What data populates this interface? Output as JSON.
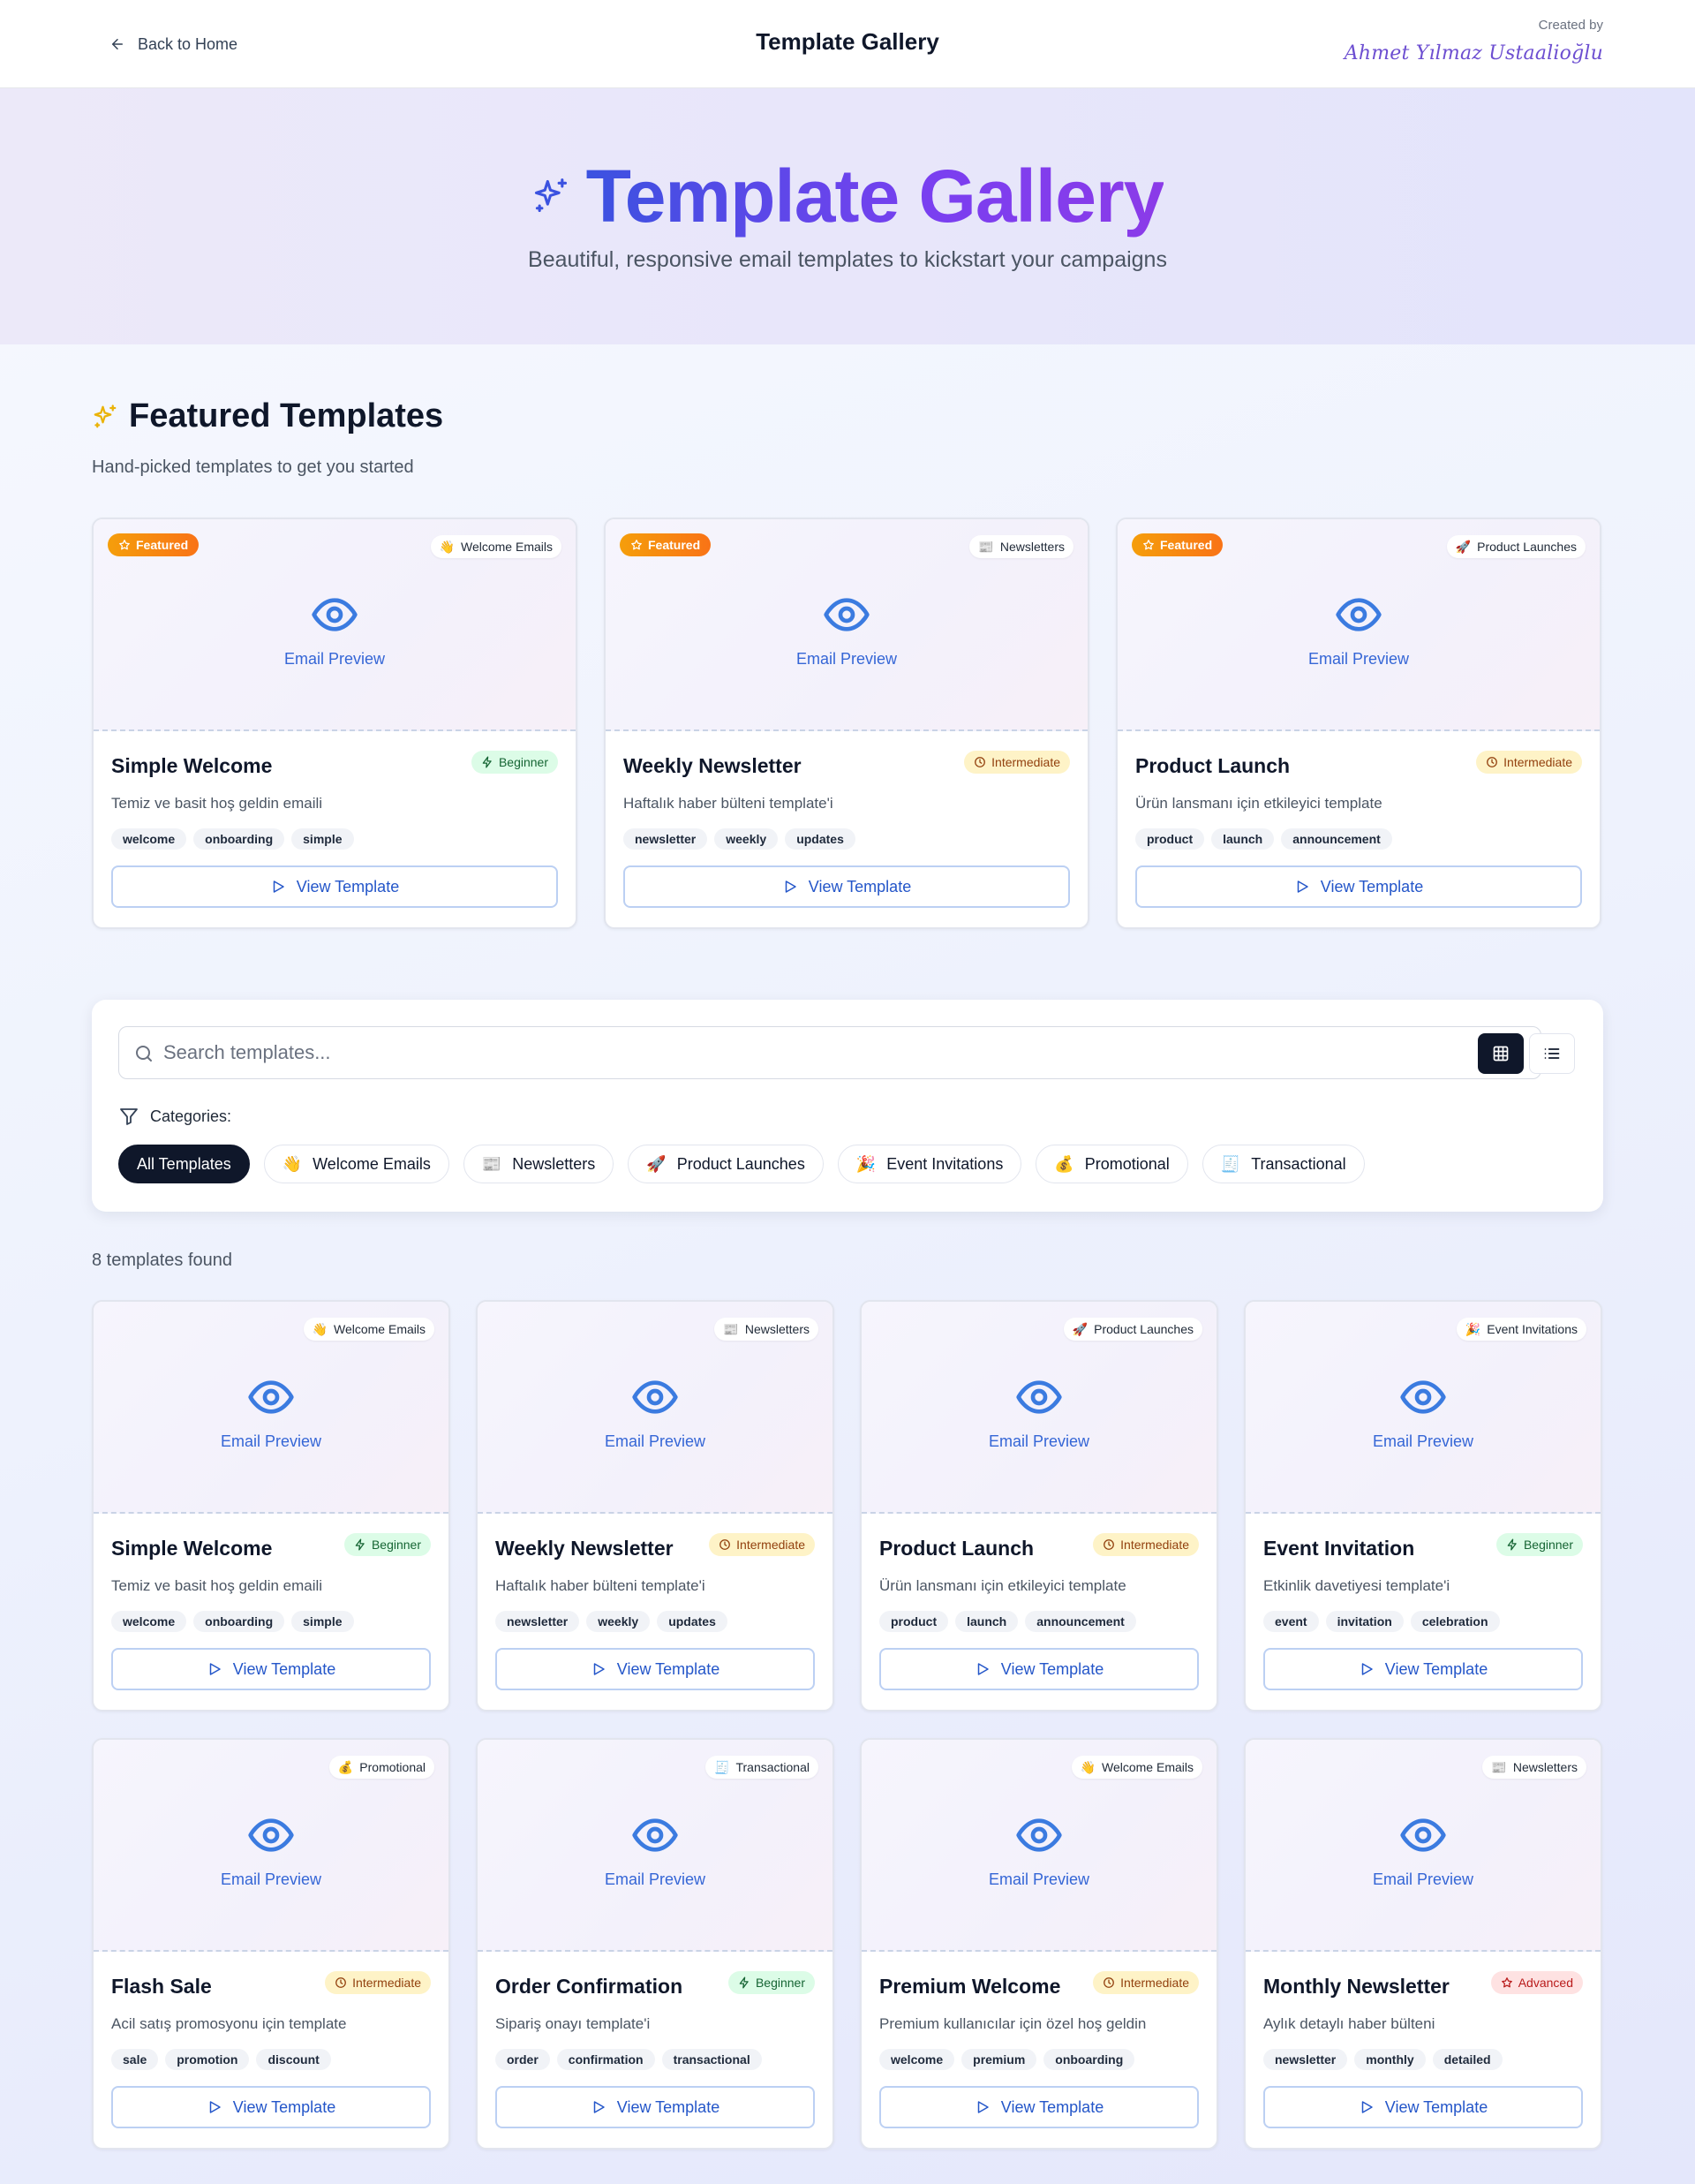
{
  "header": {
    "back_label": "Back to Home",
    "title": "Template Gallery",
    "created_by_label": "Created by",
    "author": "Ahmet Yılmaz Ustaalioğlu"
  },
  "hero": {
    "title": "Template Gallery",
    "subtitle": "Beautiful, responsive email templates to kickstart your campaigns"
  },
  "featured": {
    "title": "Featured Templates",
    "subtitle": "Hand-picked templates to get you started",
    "badge_label": "Featured",
    "cards": [
      {
        "category": "Welcome Emails",
        "category_emoji": "👋",
        "title": "Simple Welcome",
        "level": "Beginner",
        "level_type": "beginner",
        "description": "Temiz ve basit hoş geldin emaili",
        "tags": [
          "welcome",
          "onboarding",
          "simple"
        ]
      },
      {
        "category": "Newsletters",
        "category_emoji": "📰",
        "title": "Weekly Newsletter",
        "level": "Intermediate",
        "level_type": "intermediate",
        "description": "Haftalık haber bülteni template'i",
        "tags": [
          "newsletter",
          "weekly",
          "updates"
        ]
      },
      {
        "category": "Product Launches",
        "category_emoji": "🚀",
        "title": "Product Launch",
        "level": "Intermediate",
        "level_type": "intermediate",
        "description": "Ürün lansmanı için etkileyici template",
        "tags": [
          "product",
          "launch",
          "announcement"
        ]
      }
    ]
  },
  "preview_label": "Email Preview",
  "view_button_label": "View Template",
  "search": {
    "placeholder": "Search templates...",
    "value": ""
  },
  "categories": {
    "label": "Categories:",
    "items": [
      {
        "label": "All Templates",
        "emoji": "",
        "active": true
      },
      {
        "label": "Welcome Emails",
        "emoji": "👋",
        "active": false
      },
      {
        "label": "Newsletters",
        "emoji": "📰",
        "active": false
      },
      {
        "label": "Product Launches",
        "emoji": "🚀",
        "active": false
      },
      {
        "label": "Event Invitations",
        "emoji": "🎉",
        "active": false
      },
      {
        "label": "Promotional",
        "emoji": "💰",
        "active": false
      },
      {
        "label": "Transactional",
        "emoji": "🧾",
        "active": false
      }
    ]
  },
  "view_mode": {
    "selected": "grid",
    "options": [
      "grid-icon",
      "list-icon"
    ]
  },
  "results": {
    "count_text": "8 templates found",
    "cards": [
      {
        "category": "Welcome Emails",
        "category_emoji": "👋",
        "title": "Simple Welcome",
        "level": "Beginner",
        "level_type": "beginner",
        "description": "Temiz ve basit hoş geldin emaili",
        "tags": [
          "welcome",
          "onboarding",
          "simple"
        ]
      },
      {
        "category": "Newsletters",
        "category_emoji": "📰",
        "title": "Weekly Newsletter",
        "level": "Intermediate",
        "level_type": "intermediate",
        "description": "Haftalık haber bülteni template'i",
        "tags": [
          "newsletter",
          "weekly",
          "updates"
        ]
      },
      {
        "category": "Product Launches",
        "category_emoji": "🚀",
        "title": "Product Launch",
        "level": "Intermediate",
        "level_type": "intermediate",
        "description": "Ürün lansmanı için etkileyici template",
        "tags": [
          "product",
          "launch",
          "announcement"
        ]
      },
      {
        "category": "Event Invitations",
        "category_emoji": "🎉",
        "title": "Event Invitation",
        "level": "Beginner",
        "level_type": "beginner",
        "description": "Etkinlik davetiyesi template'i",
        "tags": [
          "event",
          "invitation",
          "celebration"
        ]
      },
      {
        "category": "Promotional",
        "category_emoji": "💰",
        "title": "Flash Sale",
        "level": "Intermediate",
        "level_type": "intermediate",
        "description": "Acil satış promosyonu için template",
        "tags": [
          "sale",
          "promotion",
          "discount"
        ]
      },
      {
        "category": "Transactional",
        "category_emoji": "🧾",
        "title": "Order Confirmation",
        "level": "Beginner",
        "level_type": "beginner",
        "description": "Sipariş onayı template'i",
        "tags": [
          "order",
          "confirmation",
          "transactional"
        ]
      },
      {
        "category": "Welcome Emails",
        "category_emoji": "👋",
        "title": "Premium Welcome",
        "level": "Intermediate",
        "level_type": "intermediate",
        "description": "Premium kullanıcılar için özel hoş geldin",
        "tags": [
          "welcome",
          "premium",
          "onboarding"
        ]
      },
      {
        "category": "Newsletters",
        "category_emoji": "📰",
        "title": "Monthly Newsletter",
        "level": "Advanced",
        "level_type": "advanced",
        "description": "Aylık detaylı haber bülteni",
        "tags": [
          "newsletter",
          "monthly",
          "detailed"
        ]
      }
    ]
  },
  "colors": {
    "primary": "#2456c9",
    "eye_icon": "#3b7be0",
    "featured_badge": "#f59e0b",
    "beginner": "#166534",
    "intermediate": "#92400e",
    "advanced": "#b91c1c",
    "dark": "#0f172a"
  }
}
